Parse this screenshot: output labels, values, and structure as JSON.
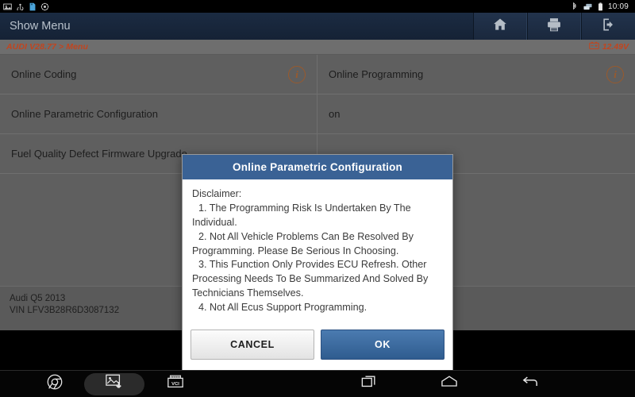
{
  "statusbar": {
    "icons": [
      "screenshot-icon",
      "usb-icon",
      "sdcard-icon",
      "settings-icon"
    ],
    "right_icons": [
      "bluetooth-icon",
      "network-icon",
      "battery-icon"
    ],
    "time": "10:09"
  },
  "header": {
    "title": "Show Menu",
    "actions": [
      {
        "name": "home-button",
        "icon": "home-icon"
      },
      {
        "name": "print-button",
        "icon": "printer-icon"
      },
      {
        "name": "exit-button",
        "icon": "exit-icon"
      }
    ]
  },
  "breadcrumb": {
    "path": "AUDI V28.77 > Menu",
    "voltage": "12.49V",
    "voltage_icon": "battery-voltage-icon",
    "accent_color": "#c1451f"
  },
  "menu": {
    "items": [
      {
        "label": "Online Coding",
        "info": "i"
      },
      {
        "label": "Online Programming",
        "info": "i"
      },
      {
        "label": "Online Parametric Configuration",
        "info": ""
      },
      {
        "label": "on",
        "info": ""
      },
      {
        "label": "Fuel Quality Defect Firmware Upgrade",
        "info": ""
      },
      {
        "label": "",
        "info": ""
      }
    ]
  },
  "vehicle": {
    "model": "Audi Q5 2013",
    "vin": "VIN LFV3B28R6D3087132"
  },
  "dialog": {
    "title": "Online Parametric Configuration",
    "lines": [
      "Disclaimer:",
      "1. The Programming Risk Is Undertaken By The Individual.",
      "2. Not All Vehicle Problems Can Be Resolved By Programming. Please Be Serious In Choosing.",
      "3. This Function Only Provides ECU Refresh. Other Processing Needs To Be Summarized And Solved By Technicians Themselves.",
      "4. Not All Ecus Support Programming."
    ],
    "cancel_label": "CANCEL",
    "ok_label": "OK",
    "title_color": "#3a6295",
    "ok_color": "#2f5c8f"
  },
  "navbar": {
    "left": [
      {
        "name": "browser-button",
        "icon": "chrome-icon"
      },
      {
        "name": "screenshot-button",
        "icon": "image-download-icon"
      },
      {
        "name": "vci-button",
        "icon": "vci-icon",
        "label": "VCI"
      }
    ],
    "right": [
      {
        "name": "recents-button",
        "icon": "recents-icon"
      },
      {
        "name": "home-nav-button",
        "icon": "home-outline-icon"
      },
      {
        "name": "back-button",
        "icon": "back-arrow-icon"
      }
    ]
  }
}
